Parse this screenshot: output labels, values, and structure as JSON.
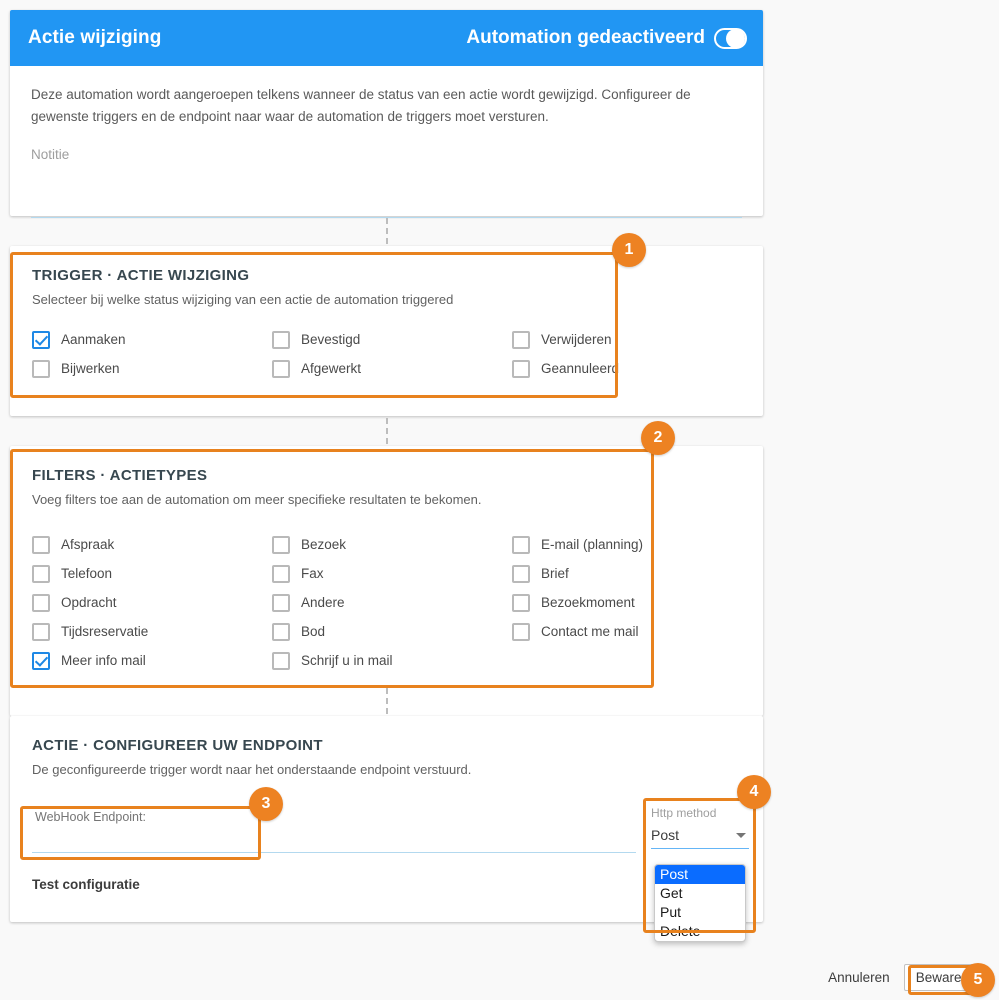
{
  "header": {
    "title": "Actie wijziging",
    "status_label": "Automation gedeactiveerd",
    "toggle_icon": "toggle-off-icon"
  },
  "intro": {
    "description": "Deze automation wordt aangeroepen telkens wanneer de status van een actie wordt gewijzigd. Configureer de gewenste triggers en de endpoint naar waar de automation de triggers moet versturen.",
    "note_placeholder": "Notitie",
    "note_value": ""
  },
  "trigger": {
    "title": "TRIGGER · ACTIE WIJZIGING",
    "subtitle": "Selecteer bij welke status wijziging van een actie de automation triggered",
    "options": [
      {
        "label": "Aanmaken",
        "checked": true
      },
      {
        "label": "Bevestigd",
        "checked": false
      },
      {
        "label": "Verwijderen",
        "checked": false
      },
      {
        "label": "Bijwerken",
        "checked": false
      },
      {
        "label": "Afgewerkt",
        "checked": false
      },
      {
        "label": "Geannuleerd",
        "checked": false
      }
    ]
  },
  "filters": {
    "title": "FILTERS · ACTIETYPES",
    "subtitle": "Voeg filters toe aan de automation om meer specifieke resultaten te bekomen.",
    "options": [
      {
        "label": "Afspraak",
        "checked": false
      },
      {
        "label": "Bezoek",
        "checked": false
      },
      {
        "label": "E-mail (planning)",
        "checked": false
      },
      {
        "label": "Telefoon",
        "checked": false
      },
      {
        "label": "Fax",
        "checked": false
      },
      {
        "label": "Brief",
        "checked": false
      },
      {
        "label": "Opdracht",
        "checked": false
      },
      {
        "label": "Andere",
        "checked": false
      },
      {
        "label": "Bezoekmoment",
        "checked": false
      },
      {
        "label": "Tijdsreservatie",
        "checked": false
      },
      {
        "label": "Bod",
        "checked": false
      },
      {
        "label": "Contact me mail",
        "checked": false
      },
      {
        "label": "Meer info mail",
        "checked": true
      },
      {
        "label": "Schrijf u in mail",
        "checked": false
      },
      {
        "label": "",
        "checked": false
      }
    ]
  },
  "action": {
    "title": "ACTIE · CONFIGUREER UW ENDPOINT",
    "subtitle": "De geconfigureerde trigger wordt naar het onderstaande endpoint verstuurd.",
    "endpoint_placeholder": "WebHook Endpoint:",
    "endpoint_value": "",
    "test_label": "Test configuratie"
  },
  "http_method": {
    "label": "Http method",
    "selected": "Post",
    "options": [
      "Post",
      "Get",
      "Put",
      "Delete"
    ],
    "caret_icon": "chevron-down-icon"
  },
  "footer": {
    "cancel_label": "Annuleren",
    "save_label": "Bewaren"
  },
  "badges": {
    "b1": "1",
    "b2": "2",
    "b3": "3",
    "b4": "4",
    "b5": "5"
  },
  "colors": {
    "header_blue": "#2196f3",
    "badge_orange": "#ed8222",
    "highlight_orange": "#e8821e",
    "checkbox_blue": "#1e88e5",
    "select_highlight": "#0a6cff",
    "page_background": "#f9f9f9"
  }
}
